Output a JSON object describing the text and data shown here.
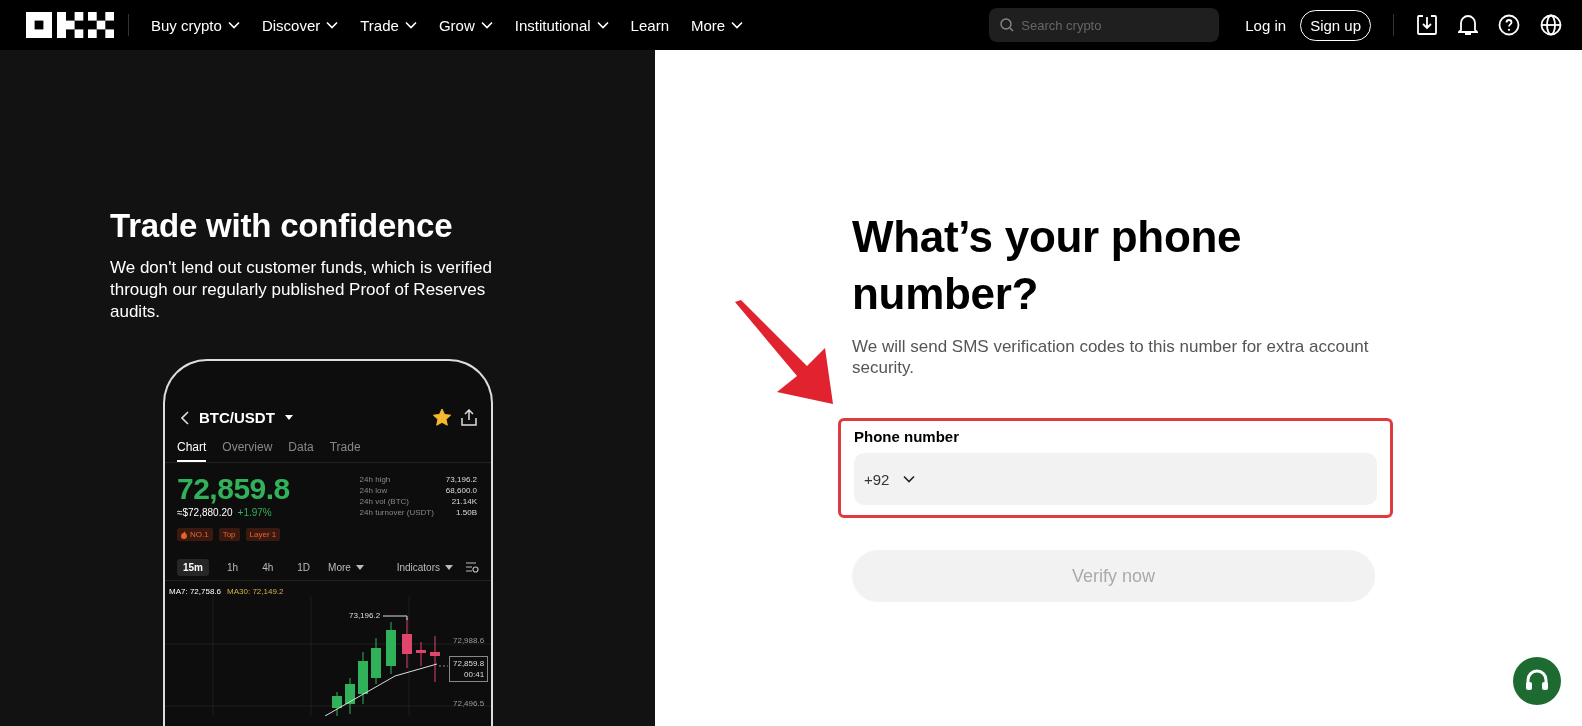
{
  "header": {
    "nav": [
      {
        "label": "Buy crypto",
        "dropdown": true
      },
      {
        "label": "Discover",
        "dropdown": true
      },
      {
        "label": "Trade",
        "dropdown": true
      },
      {
        "label": "Grow",
        "dropdown": true
      },
      {
        "label": "Institutional",
        "dropdown": true
      },
      {
        "label": "Learn",
        "dropdown": false
      },
      {
        "label": "More",
        "dropdown": true
      }
    ],
    "search": {
      "placeholder": "Search crypto"
    },
    "login": "Log in",
    "signup": "Sign up"
  },
  "promo": {
    "title": "Trade with confidence",
    "text": "We don't lend out customer funds, which is verified through our regularly published Proof of Reserves audits.",
    "phone": {
      "pair": "BTC/USDT",
      "favorite": true,
      "tabs": [
        {
          "label": "Chart",
          "selected": true
        },
        {
          "label": "Overview",
          "selected": false
        },
        {
          "label": "Data",
          "selected": false
        },
        {
          "label": "Trade",
          "selected": false
        }
      ],
      "price": "72,859.8",
      "fiat": "≈$72,880.20",
      "change": "+1.97%",
      "stats": [
        {
          "label": "24h high",
          "value": "73,196.2"
        },
        {
          "label": "24h low",
          "value": "68,600.0"
        },
        {
          "label": "24h vol (BTC)",
          "value": "21.14K"
        },
        {
          "label": "24h turnover (USDT)",
          "value": "1.50B"
        }
      ],
      "tags": [
        {
          "label": "NO.1",
          "kind": "hot"
        },
        {
          "label": "Top",
          "kind": "plain"
        },
        {
          "label": "Layer 1",
          "kind": "plain"
        }
      ],
      "intervals": [
        {
          "label": "15m",
          "selected": true
        },
        {
          "label": "1h",
          "selected": false
        },
        {
          "label": "4h",
          "selected": false
        },
        {
          "label": "1D",
          "selected": false
        }
      ],
      "more": "More",
      "indicators": "Indicators",
      "ma7": "MA7: 72,758.6",
      "ma30": "MA30: 72,149.2",
      "chart_labels": {
        "high": "73,196.2",
        "upper": "72,988.6",
        "last_price": "72,859.8",
        "countdown": "00:41",
        "lower": "72,496.5"
      }
    }
  },
  "form": {
    "title": "What’s your phone number?",
    "subtitle": "We will send SMS verification codes to this number for extra account security.",
    "field_label": "Phone number",
    "country_code": "+92",
    "highlighted": true,
    "button": {
      "label": "Verify now",
      "disabled": true
    }
  }
}
